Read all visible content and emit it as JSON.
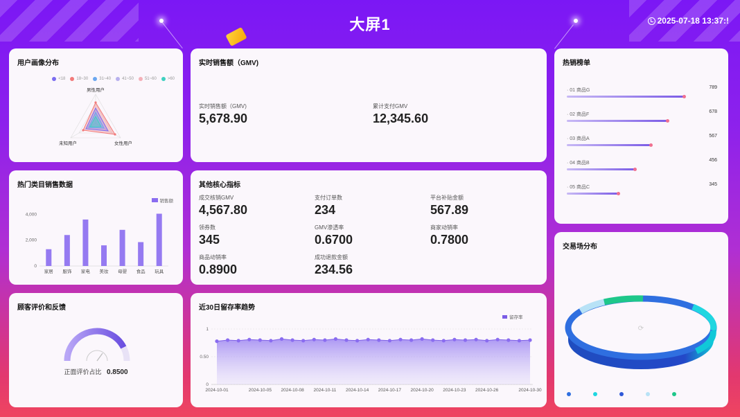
{
  "header": {
    "title": "大屏1",
    "datetime": "2025-07-18 13:37:!"
  },
  "radar_card": {
    "title": "用户画像分布",
    "legend": [
      {
        "label": "<18",
        "color": "#7b6cf0"
      },
      {
        "label": "18~30",
        "color": "#f27a7a"
      },
      {
        "label": "31~40",
        "color": "#6aa7f0"
      },
      {
        "label": "41~50",
        "color": "#b8b0ee"
      },
      {
        "label": "51~60",
        "color": "#f4b0b8"
      },
      {
        "label": ">60",
        "color": "#3fd0c0"
      }
    ],
    "axes": [
      "男性用户",
      "女性用户",
      "未知用户"
    ]
  },
  "gmv_card": {
    "title": "实时销售额（GMV)",
    "realtime_label": "实时销售额（GMV)",
    "realtime_value": "5,678.90",
    "total_label": "累计支付GMV",
    "total_value": "12,345.60"
  },
  "hot_rank": {
    "title": "热销榜单",
    "items": [
      {
        "label": "· 01  商品G",
        "value": "789",
        "ratio": 1.0
      },
      {
        "label": "· 02  商品F",
        "value": "678",
        "ratio": 0.86
      },
      {
        "label": "· 03  商品A",
        "value": "567",
        "ratio": 0.72
      },
      {
        "label": "· 04  商品B",
        "value": "456",
        "ratio": 0.58
      },
      {
        "label": "· 05  商品C",
        "value": "345",
        "ratio": 0.44
      }
    ]
  },
  "category_card": {
    "title": "热门类目销售数据",
    "legend_label": "销售额"
  },
  "core_card": {
    "title": "其他核心指标",
    "metrics": [
      {
        "label": "成交核销GMV",
        "value": "4,567.80"
      },
      {
        "label": "支付订单数",
        "value": "234"
      },
      {
        "label": "平台补贴金额",
        "value": "567.89"
      },
      {
        "label": "领券数",
        "value": "345"
      },
      {
        "label": "GMV渗透率",
        "value": "0.6700"
      },
      {
        "label": "商家动销率",
        "value": "0.7800"
      },
      {
        "label": "商品动销率",
        "value": "0.8900"
      },
      {
        "label": "成功退款金额",
        "value": "234.56"
      }
    ]
  },
  "trade_card": {
    "title": "交易场分布",
    "legend": [
      {
        "color": "#2f6fe0"
      },
      {
        "color": "#1fd6e0"
      },
      {
        "color": "#2f58d8"
      },
      {
        "color": "#b8e2f6"
      },
      {
        "color": "#1ec78a"
      }
    ],
    "center_glyph": "⟳"
  },
  "feedback_card": {
    "title": "顾客评价和反馈",
    "caption": "正面评价占比",
    "value": "0.8500",
    "ratio": 0.85
  },
  "retention_card": {
    "title": "近30日留存率趋势"
  },
  "chart_data": [
    {
      "type": "bar",
      "title": "热门类目销售数据",
      "categories": [
        "家居",
        "服饰",
        "家电",
        "美妆",
        "母婴",
        "食品",
        "玩具"
      ],
      "series": [
        {
          "name": "销售额",
          "values": [
            1300,
            2400,
            3600,
            1600,
            2800,
            1850,
            4050
          ]
        }
      ],
      "yticks": [
        "0",
        "2,000",
        "4,000"
      ],
      "ylim": [
        0,
        4400
      ],
      "color": "#8a6cf0"
    },
    {
      "type": "area",
      "title": "近30日留存率趋势",
      "x": [
        "2024-10-01",
        "2024-10-02",
        "2024-10-03",
        "2024-10-04",
        "2024-10-05",
        "2024-10-06",
        "2024-10-07",
        "2024-10-08",
        "2024-10-09",
        "2024-10-10",
        "2024-10-11",
        "2024-10-12",
        "2024-10-13",
        "2024-10-14",
        "2024-10-15",
        "2024-10-16",
        "2024-10-17",
        "2024-10-18",
        "2024-10-19",
        "2024-10-20",
        "2024-10-21",
        "2024-10-22",
        "2024-10-23",
        "2024-10-24",
        "2024-10-25",
        "2024-10-26",
        "2024-10-27",
        "2024-10-28",
        "2024-10-29",
        "2024-10-30"
      ],
      "xticks": [
        "2024-10-01",
        "2024-10-05",
        "2024-10-08",
        "2024-10-11",
        "2024-10-14",
        "2024-10-17",
        "2024-10-20",
        "2024-10-23",
        "2024-10-26",
        "2024-10-30"
      ],
      "series": [
        {
          "name": "留存率",
          "values": [
            0.78,
            0.8,
            0.79,
            0.81,
            0.8,
            0.79,
            0.82,
            0.8,
            0.79,
            0.81,
            0.8,
            0.82,
            0.8,
            0.79,
            0.81,
            0.8,
            0.79,
            0.81,
            0.8,
            0.82,
            0.8,
            0.79,
            0.81,
            0.8,
            0.81,
            0.79,
            0.81,
            0.8,
            0.79,
            0.8
          ]
        }
      ],
      "yticks": [
        "0",
        "0.50",
        "1"
      ],
      "ylim": [
        0,
        1
      ],
      "color": "#7b5ce6"
    }
  ]
}
